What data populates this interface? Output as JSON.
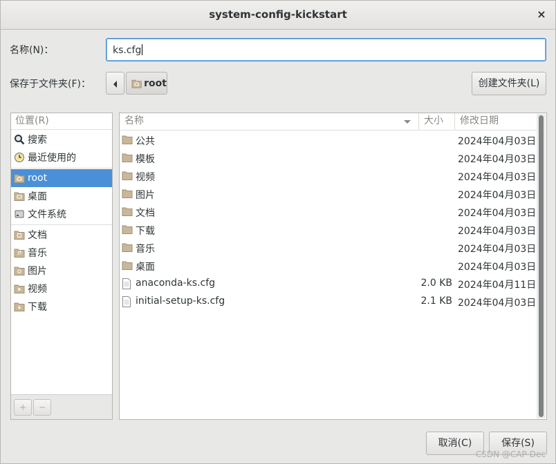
{
  "window": {
    "title": "system-config-kickstart",
    "close": "×"
  },
  "form": {
    "name_label": "名称(N)：",
    "name_value": "ks.cfg",
    "save_in_label": "保存于文件夹(F)：",
    "path_button": "root",
    "create_folder_button": "创建文件夹(L)"
  },
  "places": {
    "header": "位置(R)",
    "items": [
      {
        "label": "搜索",
        "icon": "search-icon"
      },
      {
        "label": "最近使用的",
        "icon": "recent-icon"
      },
      {
        "label": "root",
        "icon": "home-folder-icon",
        "selected": true
      },
      {
        "label": "桌面",
        "icon": "desktop-folder-icon"
      },
      {
        "label": "文件系统",
        "icon": "drive-icon"
      },
      {
        "label": "文档",
        "icon": "documents-folder-icon"
      },
      {
        "label": "音乐",
        "icon": "music-folder-icon"
      },
      {
        "label": "图片",
        "icon": "pictures-folder-icon"
      },
      {
        "label": "视频",
        "icon": "videos-folder-icon"
      },
      {
        "label": "下载",
        "icon": "downloads-folder-icon"
      }
    ],
    "add_button": "+",
    "remove_button": "−"
  },
  "files": {
    "columns": {
      "name": "名称",
      "size": "大小",
      "date": "修改日期"
    },
    "rows": [
      {
        "name": "公共",
        "size": "",
        "date": "2024年04月03日",
        "type": "folder"
      },
      {
        "name": "模板",
        "size": "",
        "date": "2024年04月03日",
        "type": "folder"
      },
      {
        "name": "视频",
        "size": "",
        "date": "2024年04月03日",
        "type": "folder"
      },
      {
        "name": "图片",
        "size": "",
        "date": "2024年04月03日",
        "type": "folder"
      },
      {
        "name": "文档",
        "size": "",
        "date": "2024年04月03日",
        "type": "folder"
      },
      {
        "name": "下载",
        "size": "",
        "date": "2024年04月03日",
        "type": "folder"
      },
      {
        "name": "音乐",
        "size": "",
        "date": "2024年04月03日",
        "type": "folder"
      },
      {
        "name": "桌面",
        "size": "",
        "date": "2024年04月03日",
        "type": "folder"
      },
      {
        "name": "anaconda-ks.cfg",
        "size": "2.0 KB",
        "date": "2024年04月11日",
        "type": "file"
      },
      {
        "name": "initial-setup-ks.cfg",
        "size": "2.1 KB",
        "date": "2024年04月03日",
        "type": "file"
      }
    ]
  },
  "buttons": {
    "cancel": "取消(C)",
    "save": "保存(S)"
  },
  "watermark": "CSDN @CAP-Dec",
  "colors": {
    "selection": "#4a90d9",
    "folder": "#c9b79a",
    "background": "#e8e8e7"
  }
}
